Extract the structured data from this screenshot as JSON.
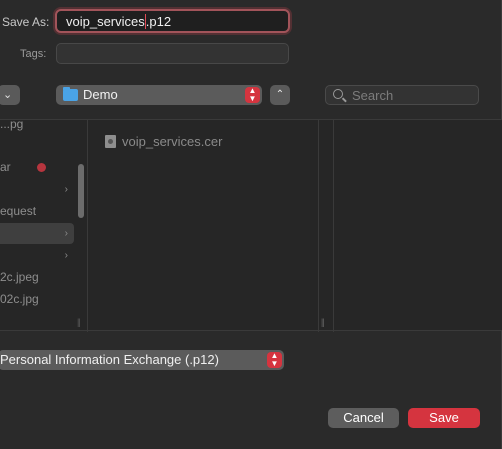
{
  "save_as": {
    "label": "Save As:",
    "value_before_caret": "voip_services",
    "value_after_caret": ".p12"
  },
  "tags": {
    "label": "Tags:",
    "value": ""
  },
  "toolbar": {
    "back_chevron": "⌄",
    "location": "Demo",
    "location_stepper": "▲▼",
    "collapse_icon": "⌃",
    "search_placeholder": "Search"
  },
  "sidebar_column": {
    "items": [
      {
        "label": "...pg"
      },
      {
        "label": "ar",
        "has_red_tag": true
      },
      {
        "label": "",
        "has_arrow": true
      },
      {
        "label": "equest"
      },
      {
        "label": "",
        "has_arrow": true,
        "selected": true
      },
      {
        "label": "",
        "has_arrow": true
      },
      {
        "label": "2c.jpeg"
      },
      {
        "label": "02c.jpg"
      }
    ],
    "arrow_glyph": "›"
  },
  "files": [
    {
      "name": "voip_services.cer"
    }
  ],
  "format": {
    "value": "Personal Information Exchange (.p12)",
    "stepper": "▲▼"
  },
  "buttons": {
    "cancel": "Cancel",
    "save": "Save"
  },
  "colors": {
    "accent": "#d5343f",
    "folder": "#4aa3e6",
    "background": "#2a2a2a"
  }
}
